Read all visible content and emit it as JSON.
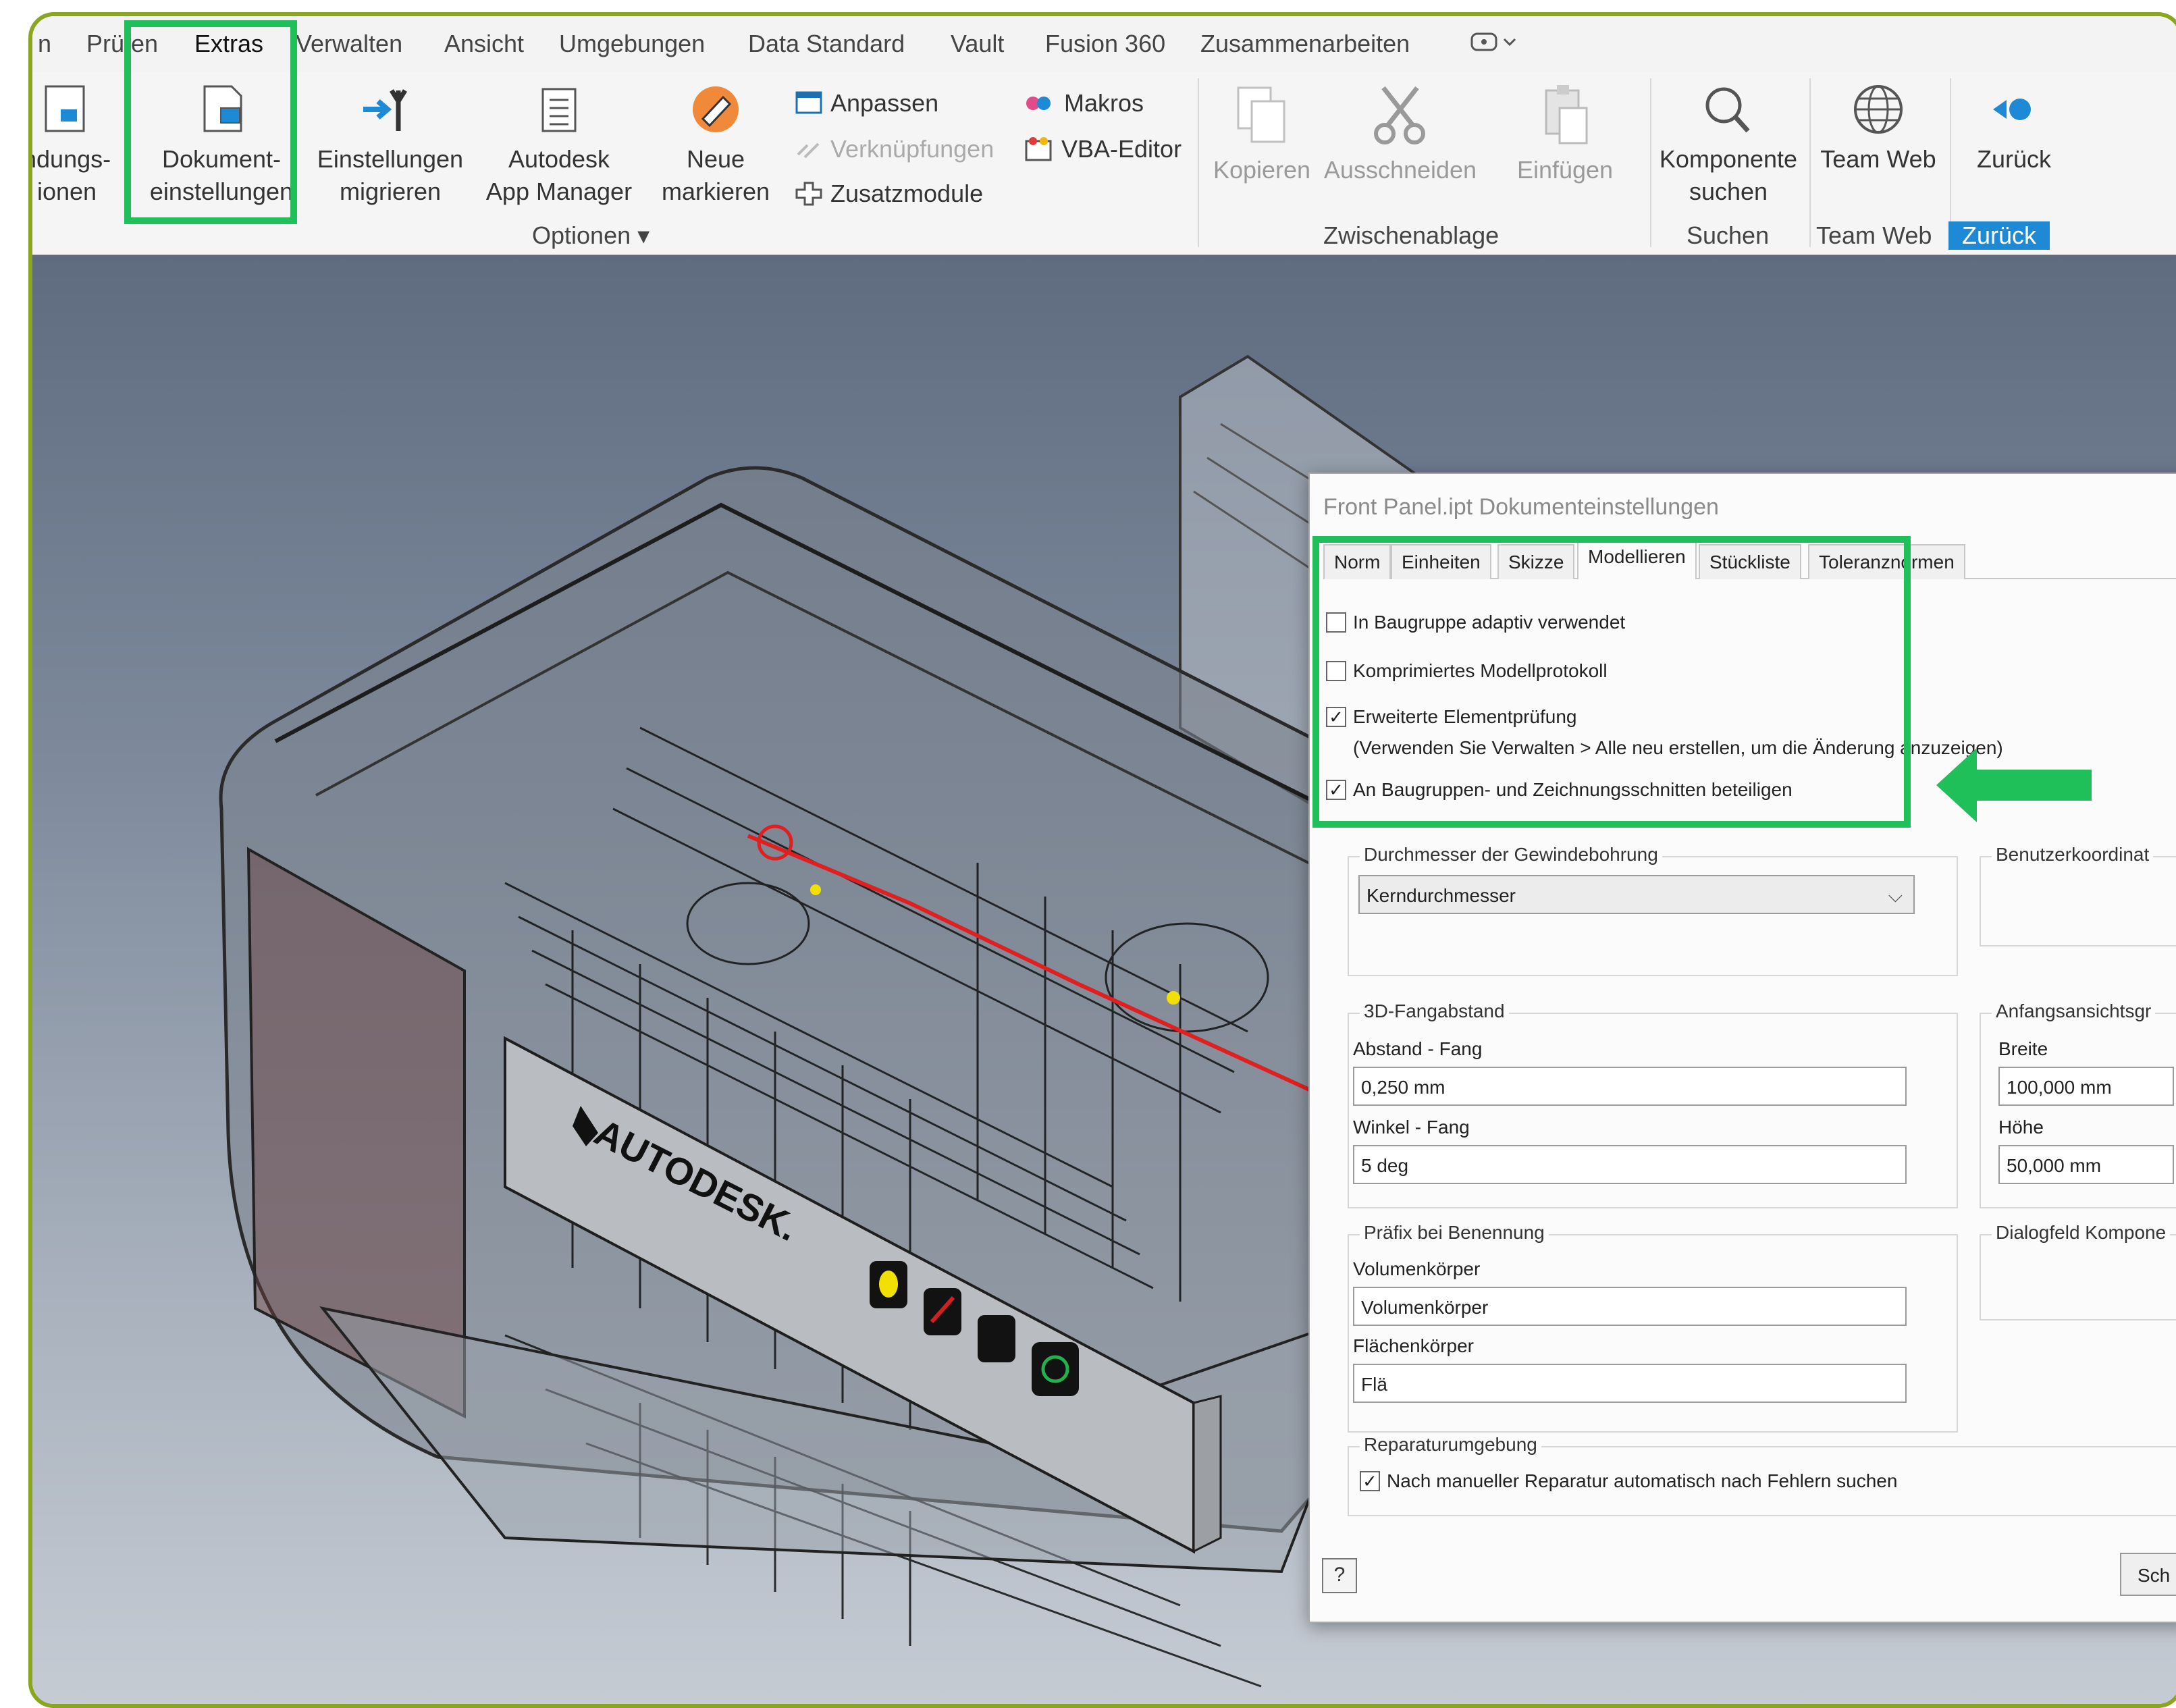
{
  "ribbon": {
    "tabs": [
      "n",
      "Prüfen",
      "Extras",
      "Verwalten",
      "Ansicht",
      "Umgebungen",
      "Data Standard",
      "Vault",
      "Fusion 360",
      "Zusammenarbeiten"
    ],
    "overflow_icon": "quick-access-dropdown",
    "buttons": {
      "anwendungs_line1": "ndungs-",
      "anwendungs_line2": "ionen",
      "dokument_line1": "Dokument-",
      "dokument_line2": "einstellungen",
      "einstellungen_line1": "Einstellungen",
      "einstellungen_line2": "migrieren",
      "autodesk_line1": "Autodesk",
      "autodesk_line2": "App Manager",
      "neue_line1": "Neue",
      "neue_line2": "markieren",
      "anpassen": "Anpassen",
      "verknuepfungen": "Verknüpfungen",
      "zusatzmodule": "Zusatzmodule",
      "makros": "Makros",
      "vba_editor": "VBA-Editor",
      "kopieren": "Kopieren",
      "ausschneiden": "Ausschneiden",
      "einfuegen": "Einfügen",
      "komponente_line1": "Komponente",
      "komponente_line2": "suchen",
      "team_web": "Team Web",
      "zurueck": "Zurück"
    },
    "groups": {
      "optionen": "Optionen",
      "zwischenablage": "Zwischenablage",
      "suchen": "Suchen",
      "team_web": "Team Web",
      "zurueck": "Zurück"
    }
  },
  "model": {
    "brand": "AUTODESK."
  },
  "dialog": {
    "title": "Front Panel.ipt Dokumenteinstellungen",
    "tabs": [
      "Norm",
      "Einheiten",
      "Skizze",
      "Modellieren",
      "Stückliste",
      "Toleranznormen"
    ],
    "active_tab": "Modellieren",
    "checkboxes": {
      "adaptiv": {
        "label": "In Baugruppe adaptiv verwendet",
        "checked": false
      },
      "komprimiert": {
        "label": "Komprimiertes Modellprotokoll",
        "checked": false
      },
      "erweitert": {
        "label": "Erweiterte Elementprüfung",
        "checked": true
      },
      "erweitert_note": "(Verwenden Sie Verwalten > Alle neu erstellen, um die Änderung anzuzeigen)",
      "baugruppen": {
        "label": "An Baugruppen- und Zeichnungsschnitten beteiligen",
        "checked": true
      }
    },
    "gewinde": {
      "legend": "Durchmesser der Gewindebohrung",
      "value": "Kerndurchmesser"
    },
    "benutzerkoord": {
      "legend": "Benutzerkoordinat"
    },
    "fang": {
      "legend": "3D-Fangabstand",
      "abstand_label": "Abstand - Fang",
      "abstand_value": "0,250 mm",
      "winkel_label": "Winkel - Fang",
      "winkel_value": "5 deg"
    },
    "anfangsansicht": {
      "legend": "Anfangsansichtsgr",
      "breite_label": "Breite",
      "breite_value": "100,000 mm",
      "hoehe_label": "Höhe",
      "hoehe_value": "50,000 mm"
    },
    "praefix": {
      "legend": "Präfix bei Benennung",
      "volumen_label": "Volumenkörper",
      "volumen_value": "Volumenkörper",
      "flaechen_label": "Flächenkörper",
      "flaechen_value": "Flä"
    },
    "dialogfeld": {
      "legend": "Dialogfeld Kompone"
    },
    "reparatur": {
      "legend": "Reparaturumgebung",
      "checkbox_label": "Nach manueller Reparatur automatisch nach Fehlern suchen",
      "checked": true
    },
    "help_glyph": "?",
    "close_button": "Sch"
  },
  "colors": {
    "highlight": "#1fbf5a",
    "frame": "#8aa520",
    "accent": "#1e8ad6"
  }
}
